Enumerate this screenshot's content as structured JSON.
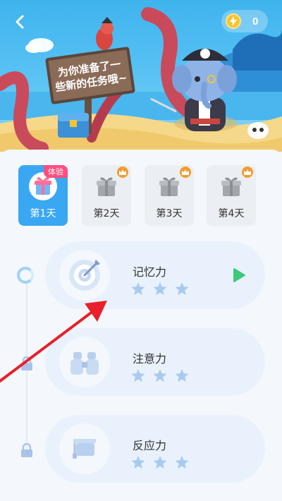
{
  "header": {
    "coin_count": "0",
    "sign_lines": [
      "为你准备了一",
      "些新的任务哦~"
    ]
  },
  "days": [
    {
      "label": "第1天",
      "badge": "体验",
      "state": "active"
    },
    {
      "label": "第2天",
      "state": "locked-premium"
    },
    {
      "label": "第3天",
      "state": "locked-premium"
    },
    {
      "label": "第4天",
      "state": "locked-premium"
    }
  ],
  "tasks": [
    {
      "title": "记忆力",
      "icon": "target-icon",
      "stars": 3,
      "state": "unlocked"
    },
    {
      "title": "注意力",
      "icon": "binoculars-icon",
      "stars": 3,
      "state": "locked"
    },
    {
      "title": "反应力",
      "icon": "graduation-cap-icon",
      "stars": 3,
      "state": "locked"
    }
  ],
  "colors": {
    "accent": "#3aa7f3",
    "star": "#a9c9ef",
    "play": "#3ec97a",
    "badge": "#ff4d7d",
    "crown": "#f59a2d",
    "annotation_arrow": "#e8202a"
  }
}
